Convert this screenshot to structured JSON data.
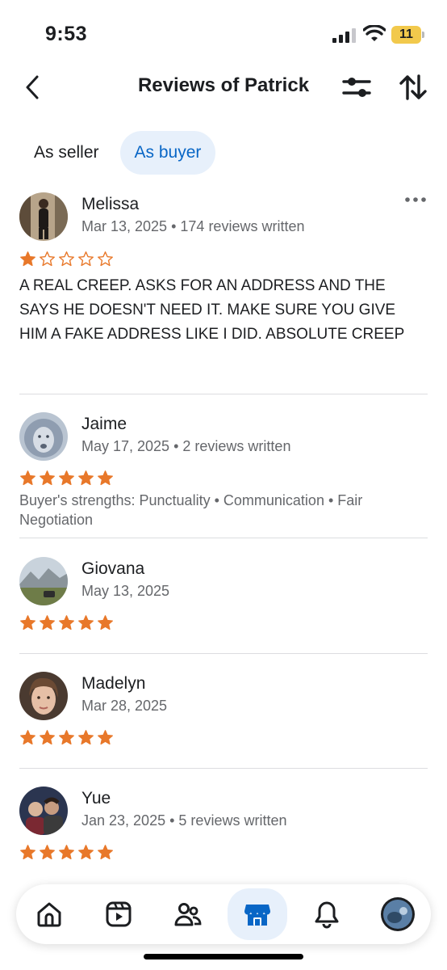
{
  "status_bar": {
    "time": "9:53",
    "battery": "11"
  },
  "header": {
    "title": "Reviews of Patrick"
  },
  "tabs": [
    {
      "label": "As seller",
      "active": false
    },
    {
      "label": "As buyer",
      "active": true
    }
  ],
  "reviews": [
    {
      "name": "Melissa",
      "date": "Mar 13, 2025",
      "reviews_written": "174 reviews written",
      "rating": 1,
      "text": "A REAL CREEP. ASKS FOR AN ADDRESS AND THE SAYS HE DOESN'T NEED IT. MAKE SURE YOU GIVE HIM A FAKE ADDRESS LIKE I DID. ABSOLUTE CREEP"
    },
    {
      "name": "Jaime",
      "date": "May 17, 2025",
      "reviews_written": "2 reviews written",
      "rating": 5,
      "strengths_label": "Buyer's strengths:",
      "strengths": [
        "Punctuality",
        "Communication",
        "Fair Negotiation"
      ]
    },
    {
      "name": "Giovana",
      "date": "May 13, 2025",
      "rating": 5
    },
    {
      "name": "Madelyn",
      "date": "Mar 28, 2025",
      "rating": 5
    },
    {
      "name": "Yue",
      "date": "Jan 23, 2025",
      "reviews_written": "5 reviews written",
      "rating": 5
    }
  ],
  "colors": {
    "star": "#e8782a",
    "accent": "#0866c6",
    "active_bg": "#e7f0fb",
    "secondary_text": "#65676b"
  },
  "icons": {
    "back": "chevron-left-icon",
    "filter": "sliders-icon",
    "sort": "sort-arrows-icon",
    "more": "more-horizontal-icon",
    "nav": [
      "home-icon",
      "video-icon",
      "friends-icon",
      "marketplace-icon",
      "bell-icon",
      "profile-avatar"
    ]
  }
}
